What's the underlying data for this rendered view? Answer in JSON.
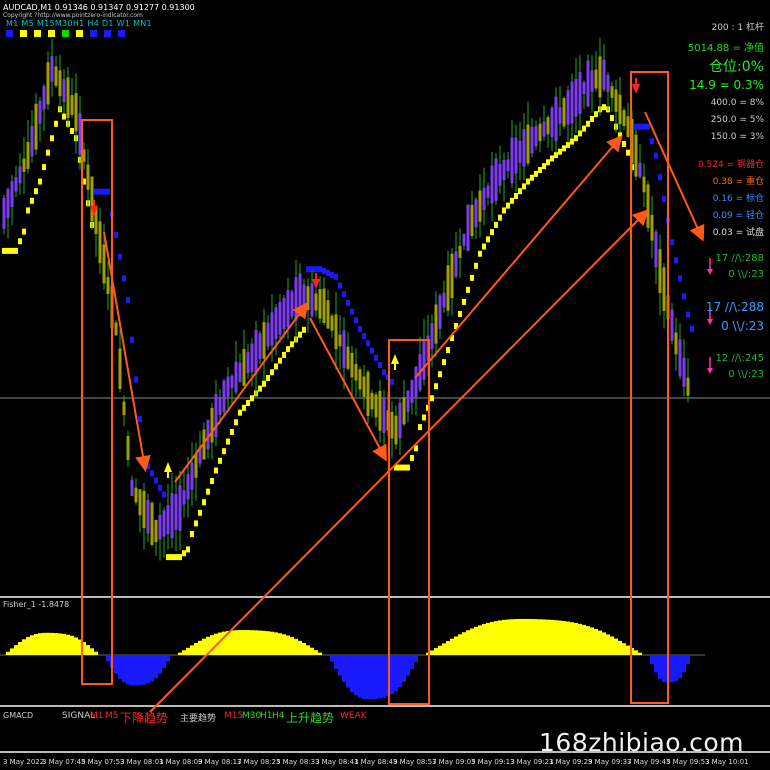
{
  "header": {
    "symbol_info": "AUDCAD,M1  0.91346 0.91347 0.91277 0.91300",
    "copyright": "Copyright ?http://www.pointzero-indicator.com",
    "timeframes": "M1  M5  M15M30H1   H4   D1  W1  MN1"
  },
  "trend_squares": {
    "colors": [
      "#1a1aff",
      "#ffff00",
      "#ffff00",
      "#ffff00",
      "#00dd00",
      "#ffff00",
      "#1a1aff",
      "#1a1aff",
      "#1a1aff"
    ]
  },
  "right_panel": {
    "spread": "200 : 1 杠杆",
    "equity": "5014.88 = 净值",
    "position": "仓位:0%",
    "risk1": "14.9 = 0.3%",
    "r400": "400.0 = 8%",
    "r250": "250.0 = 5%",
    "r150": "150.0 = 3%",
    "lvl1": "0.524 = 钢器仓",
    "lvl2": "0.38 = 重仓",
    "lvl3": "0.16 = 标仓",
    "lvl4": "0.09 = 轻仓",
    "lvl5": "0.03 = 试盘",
    "s1a": "17 //\\:288",
    "s1b": "0 \\\\/:23",
    "s2a": "17 //\\:288",
    "s2b": "0 \\\\/:23",
    "s3a": "12 //\\:245",
    "s3b": "0 \\\\/:23"
  },
  "subwindows": {
    "fisher_label": "Fisher_1 -1.8478",
    "gmacd_label": "GMACD"
  },
  "signal_bar": {
    "signal": "SIGNAL",
    "m1": "M1",
    "m5": "M5",
    "down_trend": "下降趋势",
    "main_trend": "主要趋势",
    "m15": "M15",
    "m30": "M30",
    "h1": "H1",
    "h4": "H4",
    "up_trend": "上升趋势",
    "weak": "WEAK"
  },
  "time_axis": [
    "3 May 2022",
    "3 May 07:45",
    "3 May 07:53",
    "3 May 08:01",
    "3 May 08:09",
    "3 May 08:17",
    "3 May 08:25",
    "3 May 08:33",
    "3 May 08:41",
    "3 May 08:49",
    "3 May 08:57",
    "3 May 09:05",
    "3 May 09:13",
    "3 May 09:21",
    "3 May 09:29",
    "3 May 09:37",
    "3 May 09:45",
    "3 May 09:53",
    "3 May 10:01"
  ],
  "watermark": "168zhibiao.com",
  "colors": {
    "bull_candle": "#7b3cf0",
    "bear_candle": "#a0a000",
    "wick": "#22aa22",
    "trail_up": "#ffff00",
    "trail_down": "#1a1aff",
    "annotation": "#ff5a1a",
    "hist_pos": "#ffff00",
    "hist_neg": "#1a1aff"
  },
  "chart_data": {
    "type": "candlestick",
    "symbol": "AUDCAD",
    "timeframe": "M1",
    "ohlc_last": {
      "open": 0.91346,
      "high": 0.91347,
      "low": 0.91277,
      "close": 0.913
    },
    "close_path": [
      [
        0,
        0.915
      ],
      [
        6,
        0.917
      ],
      [
        12,
        0.92
      ],
      [
        18,
        0.9185
      ],
      [
        24,
        0.914
      ],
      [
        28,
        0.911
      ],
      [
        32,
        0.9055
      ],
      [
        38,
        0.904
      ],
      [
        44,
        0.9048
      ],
      [
        50,
        0.907
      ],
      [
        56,
        0.909
      ],
      [
        62,
        0.91
      ],
      [
        68,
        0.9112
      ],
      [
        74,
        0.9122
      ],
      [
        80,
        0.9118
      ],
      [
        86,
        0.91
      ],
      [
        92,
        0.9085
      ],
      [
        98,
        0.9075
      ],
      [
        104,
        0.9095
      ],
      [
        110,
        0.912
      ],
      [
        116,
        0.9145
      ],
      [
        122,
        0.916
      ],
      [
        128,
        0.917
      ],
      [
        134,
        0.9178
      ],
      [
        140,
        0.9185
      ],
      [
        146,
        0.9195
      ],
      [
        150,
        0.9198
      ],
      [
        156,
        0.918
      ],
      [
        160,
        0.916
      ],
      [
        164,
        0.913
      ],
      [
        168,
        0.9105
      ],
      [
        172,
        0.9085
      ]
    ],
    "fisher_histogram": {
      "name": "Fisher_1",
      "last_value": -1.8478
    }
  }
}
